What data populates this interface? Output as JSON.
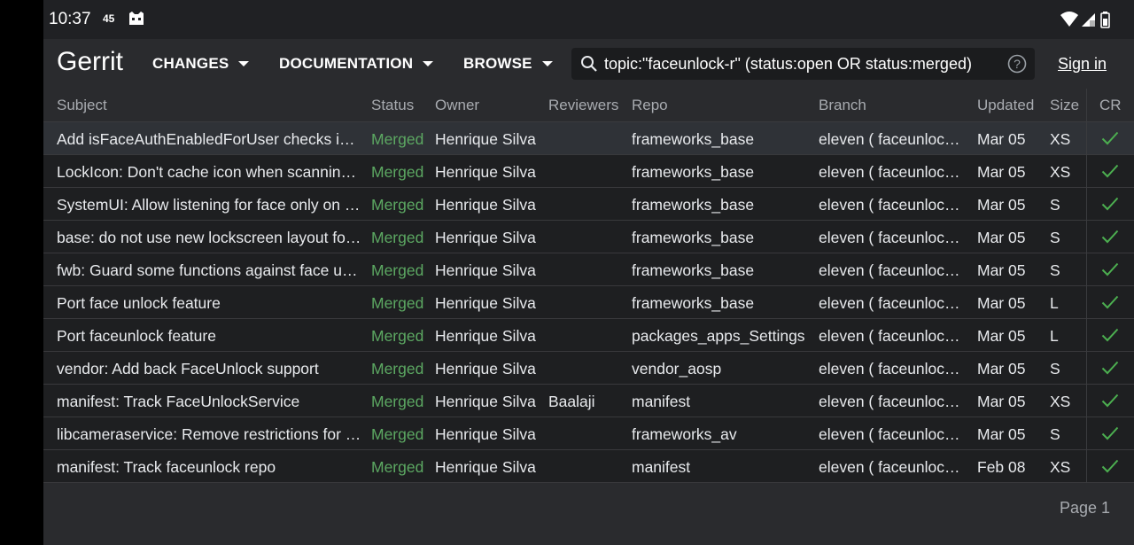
{
  "status_bar": {
    "time": "10:37",
    "indicator": "45",
    "icons": [
      "ghost-icon",
      "wifi-icon",
      "signal-icon",
      "battery-icon"
    ]
  },
  "header": {
    "brand": "Gerrit",
    "nav": [
      "CHANGES",
      "DOCUMENTATION",
      "BROWSE"
    ],
    "search_value": "topic:\"faceunlock-r\" (status:open OR status:merged)",
    "sign_in": "Sign in"
  },
  "table": {
    "columns": [
      "Subject",
      "Status",
      "Owner",
      "Reviewers",
      "Repo",
      "Branch",
      "Updated",
      "Size",
      "CR"
    ],
    "rows": [
      {
        "subject": "Add isFaceAuthEnabledForUser checks in KeyguardUpdateMonitor",
        "status": "Merged",
        "owner": "Henrique Silva",
        "reviewers": "",
        "repo": "frameworks_base",
        "branch": "eleven ( faceunlock-r )",
        "updated": "Mar 05",
        "size": "XS"
      },
      {
        "subject": "LockIcon: Don't cache icon when scanning face",
        "status": "Merged",
        "owner": "Henrique Silva",
        "reviewers": "",
        "repo": "frameworks_base",
        "branch": "eleven ( faceunlock-r )",
        "updated": "Mar 05",
        "size": "XS"
      },
      {
        "subject": "SystemUI: Allow listening for face only on pin/pattern",
        "status": "Merged",
        "owner": "Henrique Silva",
        "reviewers": "",
        "repo": "frameworks_base",
        "branch": "eleven ( faceunlock-r )",
        "updated": "Mar 05",
        "size": "S"
      },
      {
        "subject": "base: do not use new lockscreen layout for bypass",
        "status": "Merged",
        "owner": "Henrique Silva",
        "reviewers": "",
        "repo": "frameworks_base",
        "branch": "eleven ( faceunlock-r )",
        "updated": "Mar 05",
        "size": "S"
      },
      {
        "subject": "fwb: Guard some functions against face unlock absence",
        "status": "Merged",
        "owner": "Henrique Silva",
        "reviewers": "",
        "repo": "frameworks_base",
        "branch": "eleven ( faceunlock-r )",
        "updated": "Mar 05",
        "size": "S"
      },
      {
        "subject": "Port face unlock feature",
        "status": "Merged",
        "owner": "Henrique Silva",
        "reviewers": "",
        "repo": "frameworks_base",
        "branch": "eleven ( faceunlock-r )",
        "updated": "Mar 05",
        "size": "L"
      },
      {
        "subject": "Port faceunlock feature",
        "status": "Merged",
        "owner": "Henrique Silva",
        "reviewers": "",
        "repo": "packages_apps_Settings",
        "branch": "eleven ( faceunlock-r )",
        "updated": "Mar 05",
        "size": "L"
      },
      {
        "subject": "vendor: Add back FaceUnlock support",
        "status": "Merged",
        "owner": "Henrique Silva",
        "reviewers": "",
        "repo": "vendor_aosp",
        "branch": "eleven ( faceunlock-r )",
        "updated": "Mar 05",
        "size": "S"
      },
      {
        "subject": "manifest: Track FaceUnlockService",
        "status": "Merged",
        "owner": "Henrique Silva",
        "reviewers": "Baalaji",
        "repo": "manifest",
        "branch": "eleven ( faceunlock-r )",
        "updated": "Mar 05",
        "size": "XS"
      },
      {
        "subject": "libcameraservice: Remove restrictions for face unlock",
        "status": "Merged",
        "owner": "Henrique Silva",
        "reviewers": "",
        "repo": "frameworks_av",
        "branch": "eleven ( faceunlock-r )",
        "updated": "Mar 05",
        "size": "S"
      },
      {
        "subject": "manifest: Track faceunlock repo",
        "status": "Merged",
        "owner": "Henrique Silva",
        "reviewers": "",
        "repo": "manifest",
        "branch": "eleven ( faceunlock-r )",
        "updated": "Feb 08",
        "size": "XS"
      }
    ]
  },
  "footer": {
    "page": "Page 1"
  },
  "colors": {
    "merged": "#5ca862",
    "check": "#4caf50",
    "background": "#2a2b2e"
  }
}
